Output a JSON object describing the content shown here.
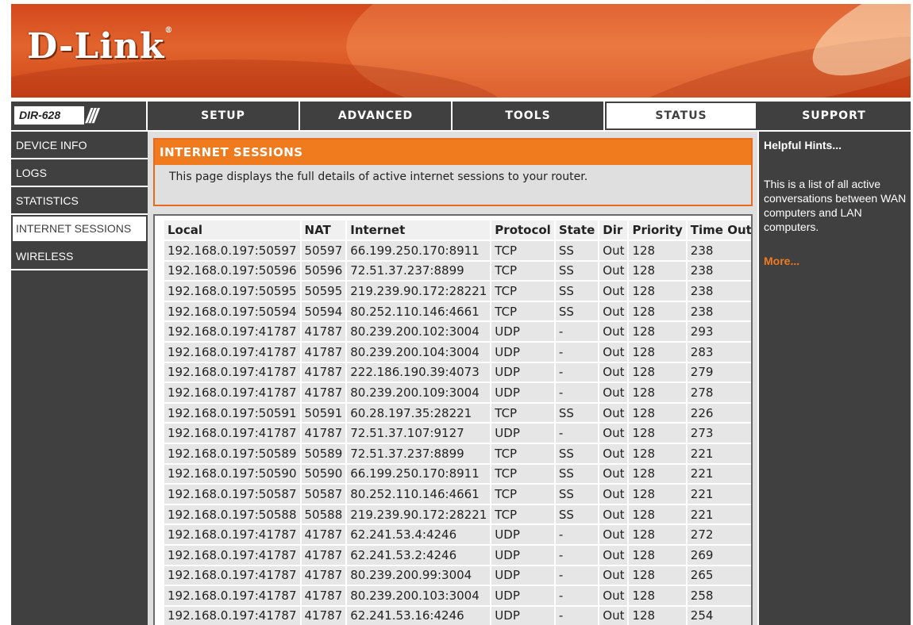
{
  "brand": {
    "logo_text": "D-Link",
    "logo_mark": "®",
    "model": "DIR-628",
    "model_slashes": "///"
  },
  "nav": {
    "tabs": [
      {
        "label": "SETUP",
        "active": false
      },
      {
        "label": "ADVANCED",
        "active": false
      },
      {
        "label": "TOOLS",
        "active": false
      },
      {
        "label": "STATUS",
        "active": true
      },
      {
        "label": "SUPPORT",
        "active": false
      }
    ]
  },
  "sidebar": {
    "items": [
      {
        "label": "DEVICE INFO",
        "active": false
      },
      {
        "label": "LOGS",
        "active": false
      },
      {
        "label": "STATISTICS",
        "active": false
      },
      {
        "label": "INTERNET SESSIONS",
        "active": true
      },
      {
        "label": "WIRELESS",
        "active": false
      }
    ]
  },
  "main": {
    "title": "INTERNET SESSIONS",
    "description": "This page displays the full details of active internet sessions to your router.",
    "table": {
      "headers": [
        "Local",
        "NAT",
        "Internet",
        "Protocol",
        "State",
        "Dir",
        "Priority",
        "Time Out"
      ],
      "rows": [
        [
          "192.168.0.197:50597",
          "50597",
          "66.199.250.170:8911",
          "TCP",
          "SS",
          "Out",
          "128",
          "238"
        ],
        [
          "192.168.0.197:50596",
          "50596",
          "72.51.37.237:8899",
          "TCP",
          "SS",
          "Out",
          "128",
          "238"
        ],
        [
          "192.168.0.197:50595",
          "50595",
          "219.239.90.172:28221",
          "TCP",
          "SS",
          "Out",
          "128",
          "238"
        ],
        [
          "192.168.0.197:50594",
          "50594",
          "80.252.110.146:4661",
          "TCP",
          "SS",
          "Out",
          "128",
          "238"
        ],
        [
          "192.168.0.197:41787",
          "41787",
          "80.239.200.102:3004",
          "UDP",
          "-",
          "Out",
          "128",
          "293"
        ],
        [
          "192.168.0.197:41787",
          "41787",
          "80.239.200.104:3004",
          "UDP",
          "-",
          "Out",
          "128",
          "283"
        ],
        [
          "192.168.0.197:41787",
          "41787",
          "222.186.190.39:4073",
          "UDP",
          "-",
          "Out",
          "128",
          "279"
        ],
        [
          "192.168.0.197:41787",
          "41787",
          "80.239.200.109:3004",
          "UDP",
          "-",
          "Out",
          "128",
          "278"
        ],
        [
          "192.168.0.197:50591",
          "50591",
          "60.28.197.35:28221",
          "TCP",
          "SS",
          "Out",
          "128",
          "226"
        ],
        [
          "192.168.0.197:41787",
          "41787",
          "72.51.37.107:9127",
          "UDP",
          "-",
          "Out",
          "128",
          "273"
        ],
        [
          "192.168.0.197:50589",
          "50589",
          "72.51.37.237:8899",
          "TCP",
          "SS",
          "Out",
          "128",
          "221"
        ],
        [
          "192.168.0.197:50590",
          "50590",
          "66.199.250.170:8911",
          "TCP",
          "SS",
          "Out",
          "128",
          "221"
        ],
        [
          "192.168.0.197:50587",
          "50587",
          "80.252.110.146:4661",
          "TCP",
          "SS",
          "Out",
          "128",
          "221"
        ],
        [
          "192.168.0.197:50588",
          "50588",
          "219.239.90.172:28221",
          "TCP",
          "SS",
          "Out",
          "128",
          "221"
        ],
        [
          "192.168.0.197:41787",
          "41787",
          "62.241.53.4:4246",
          "UDP",
          "-",
          "Out",
          "128",
          "272"
        ],
        [
          "192.168.0.197:41787",
          "41787",
          "62.241.53.2:4246",
          "UDP",
          "-",
          "Out",
          "128",
          "269"
        ],
        [
          "192.168.0.197:41787",
          "41787",
          "80.239.200.99:3004",
          "UDP",
          "-",
          "Out",
          "128",
          "265"
        ],
        [
          "192.168.0.197:41787",
          "41787",
          "80.239.200.103:3004",
          "UDP",
          "-",
          "Out",
          "128",
          "258"
        ],
        [
          "192.168.0.197:41787",
          "41787",
          "62.241.53.16:4246",
          "UDP",
          "-",
          "Out",
          "128",
          "254"
        ]
      ]
    }
  },
  "hints": {
    "title": "Helpful Hints...",
    "body": "This is a list of all active conversations between WAN computers and LAN computers.",
    "more": "More..."
  },
  "colors": {
    "accent": "#f07a1e",
    "nav_bg": "#404040",
    "banner": "#e2642d"
  }
}
